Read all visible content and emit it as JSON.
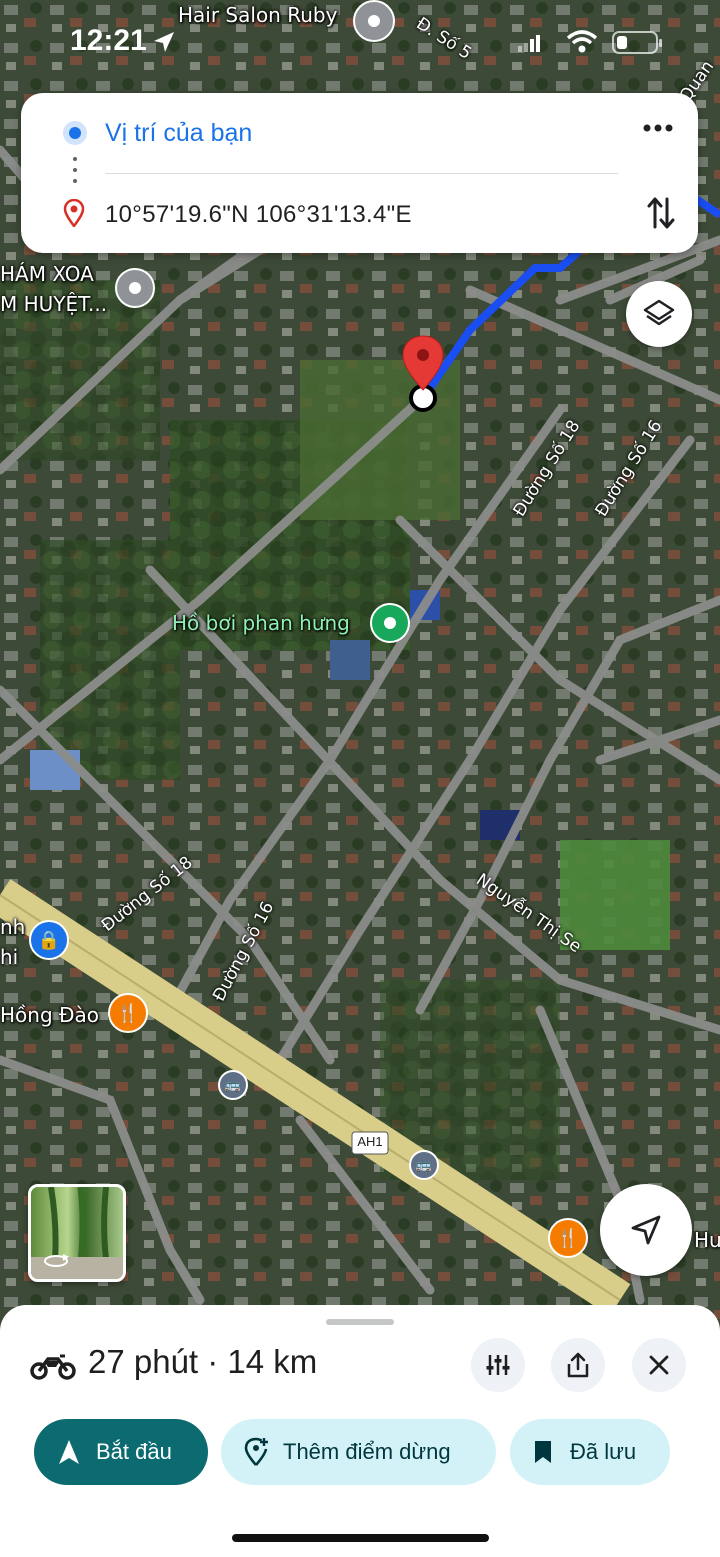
{
  "status_bar": {
    "time": "12:21"
  },
  "route_card": {
    "origin": "Vị trí của bạn",
    "destination": "10°57'19.6\"N 106°31'13.4\"E"
  },
  "map": {
    "labels": {
      "hair_salon": "Hair Salon Ruby",
      "road_so5": "Đ. Số 5",
      "quan": "Quan",
      "cham_xoa_1": "HÁM XOA",
      "cham_xoa_2": "M HUYỆT...",
      "duong_so18_top": "Đường Số 18",
      "duong_so16_top": "Đường Số 16",
      "ho_boi": "Hồ bơi phan hưng",
      "nguyen_thi_se": "Nguyễn Thị Se",
      "duong_so18_bottom": "Đường Số 18",
      "duong_so16_bottom": "Đường Số 16",
      "nh": "nh",
      "hi": "hi",
      "hong_dao": "Hồng Đào",
      "highway": "AH1",
      "hu": "Hư"
    }
  },
  "bottom_sheet": {
    "eta": "27 phút · 14 km",
    "start_label": "Bắt đầu",
    "add_stop_label": "Thêm điểm dừng",
    "saved_label": "Đã lưu"
  },
  "colors": {
    "accent_blue": "#1a73e8",
    "start_button": "#0b6b70",
    "chip_bg": "#d3f2f7",
    "route": "#1a4df2",
    "pin": "#e53935"
  }
}
